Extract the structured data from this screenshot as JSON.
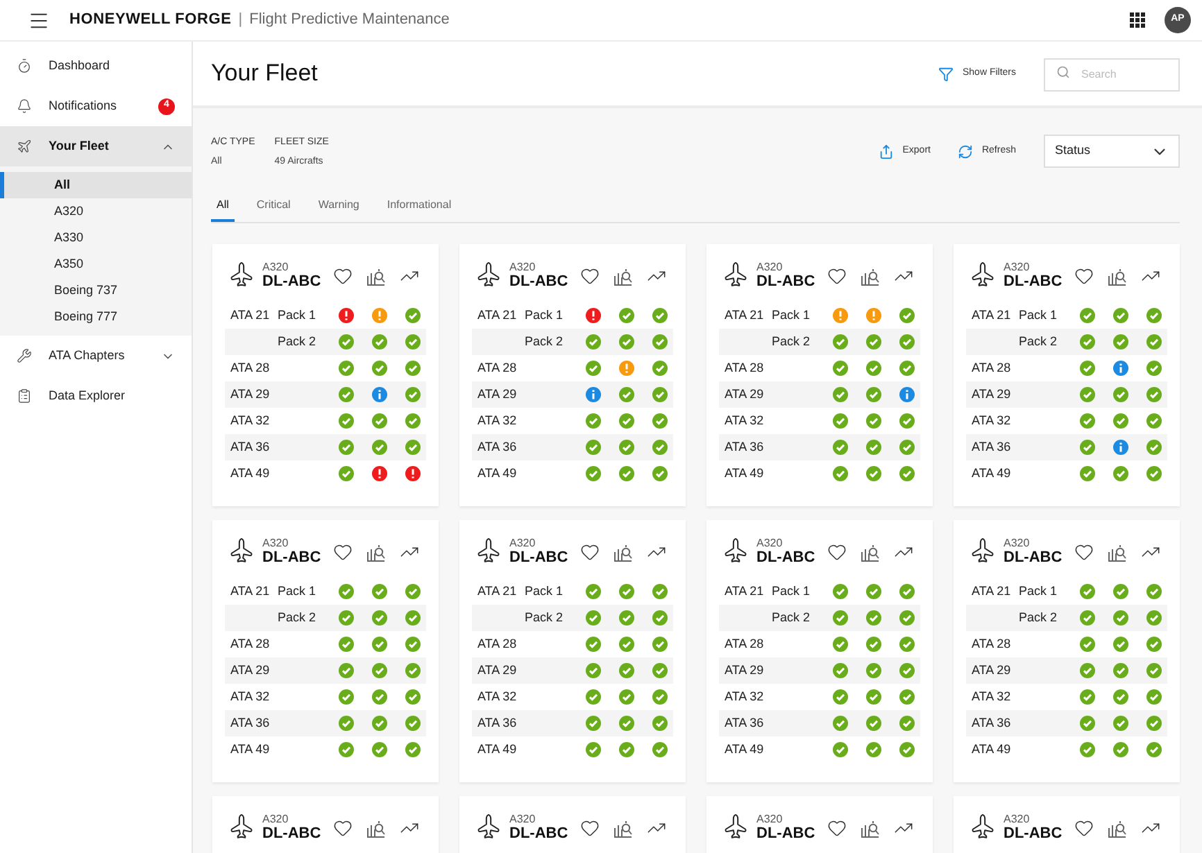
{
  "header": {
    "brand": "HONEYWELL FORGE",
    "separator": "|",
    "product": "Flight Predictive Maintenance",
    "avatar": "AP"
  },
  "sidebar": {
    "items": [
      {
        "label": "Dashboard",
        "selected": false
      },
      {
        "label": "Notifications",
        "badge": "4",
        "selected": false
      },
      {
        "label": "Your Fleet",
        "expanded": true,
        "selected": true,
        "children": [
          {
            "label": "All",
            "selected": true
          },
          {
            "label": "A320",
            "selected": false
          },
          {
            "label": "A330",
            "selected": false
          },
          {
            "label": "A350",
            "selected": false
          },
          {
            "label": "Boeing 737",
            "selected": false
          },
          {
            "label": "Boeing 777",
            "selected": false
          }
        ]
      },
      {
        "label": "ATA Chapters",
        "expanded": false,
        "selected": false
      },
      {
        "label": "Data Explorer",
        "selected": false
      }
    ]
  },
  "page": {
    "title": "Your Fleet",
    "show_filters": "Show Filters",
    "search": {
      "placeholder": "Search"
    }
  },
  "summary": [
    {
      "label": "A/C TYPE",
      "value": "All"
    },
    {
      "label": "FLEET SIZE",
      "value": "49 Aircrafts"
    }
  ],
  "actions": [
    "Export",
    "Refresh"
  ],
  "sort": {
    "value": "Status"
  },
  "tabs": [
    {
      "label": "All",
      "selected": true
    },
    {
      "label": "Critical",
      "selected": false
    },
    {
      "label": "Warning",
      "selected": false
    },
    {
      "label": "Informational",
      "selected": false
    }
  ],
  "cards": [
    {
      "type": "A320",
      "tail": "DL-ABC",
      "rows": [
        {
          "ata": "ATA 21",
          "sub": "Pack 1",
          "statuses": [
            {
              "kind": "critical"
            },
            {
              "kind": "warning"
            },
            {
              "kind": "ok"
            }
          ]
        },
        {
          "sub": "Pack 2",
          "statuses": [
            {
              "kind": "ok"
            },
            {
              "kind": "ok"
            },
            {
              "kind": "ok"
            }
          ]
        },
        {
          "ata": "ATA 28",
          "statuses": [
            {
              "kind": "ok"
            },
            {
              "kind": "ok"
            },
            {
              "kind": "ok"
            }
          ]
        },
        {
          "ata": "ATA 29",
          "statuses": [
            {
              "kind": "ok"
            },
            {
              "kind": "info"
            },
            {
              "kind": "ok"
            }
          ]
        },
        {
          "ata": "ATA 32",
          "statuses": [
            {
              "kind": "ok"
            },
            {
              "kind": "ok"
            },
            {
              "kind": "ok"
            }
          ]
        },
        {
          "ata": "ATA 36",
          "statuses": [
            {
              "kind": "ok"
            },
            {
              "kind": "ok"
            },
            {
              "kind": "ok"
            }
          ]
        },
        {
          "ata": "ATA 49",
          "statuses": [
            {
              "kind": "ok"
            },
            {
              "kind": "critical"
            },
            {
              "kind": "critical"
            }
          ]
        }
      ]
    },
    {
      "type": "A320",
      "tail": "DL-ABC",
      "rows": [
        {
          "ata": "ATA 21",
          "sub": "Pack 1",
          "statuses": [
            {
              "kind": "critical"
            },
            {
              "kind": "ok"
            },
            {
              "kind": "ok"
            }
          ]
        },
        {
          "sub": "Pack 2",
          "statuses": [
            {
              "kind": "ok"
            },
            {
              "kind": "ok"
            },
            {
              "kind": "ok"
            }
          ]
        },
        {
          "ata": "ATA 28",
          "statuses": [
            {
              "kind": "ok"
            },
            {
              "kind": "warning"
            },
            {
              "kind": "ok"
            }
          ]
        },
        {
          "ata": "ATA 29",
          "statuses": [
            {
              "kind": "info"
            },
            {
              "kind": "ok"
            },
            {
              "kind": "ok"
            }
          ]
        },
        {
          "ata": "ATA 32",
          "statuses": [
            {
              "kind": "ok"
            },
            {
              "kind": "ok"
            },
            {
              "kind": "ok"
            }
          ]
        },
        {
          "ata": "ATA 36",
          "statuses": [
            {
              "kind": "ok"
            },
            {
              "kind": "ok"
            },
            {
              "kind": "ok"
            }
          ]
        },
        {
          "ata": "ATA 49",
          "statuses": [
            {
              "kind": "ok"
            },
            {
              "kind": "ok"
            },
            {
              "kind": "ok"
            }
          ]
        }
      ]
    },
    {
      "type": "A320",
      "tail": "DL-ABC",
      "rows": [
        {
          "ata": "ATA 21",
          "sub": "Pack 1",
          "statuses": [
            {
              "kind": "warning"
            },
            {
              "kind": "warning"
            },
            {
              "kind": "ok"
            }
          ]
        },
        {
          "sub": "Pack 2",
          "statuses": [
            {
              "kind": "ok"
            },
            {
              "kind": "ok"
            },
            {
              "kind": "ok"
            }
          ]
        },
        {
          "ata": "ATA 28",
          "statuses": [
            {
              "kind": "ok"
            },
            {
              "kind": "ok"
            },
            {
              "kind": "ok"
            }
          ]
        },
        {
          "ata": "ATA 29",
          "statuses": [
            {
              "kind": "ok"
            },
            {
              "kind": "ok"
            },
            {
              "kind": "info"
            }
          ]
        },
        {
          "ata": "ATA 32",
          "statuses": [
            {
              "kind": "ok"
            },
            {
              "kind": "ok"
            },
            {
              "kind": "ok"
            }
          ]
        },
        {
          "ata": "ATA 36",
          "statuses": [
            {
              "kind": "ok"
            },
            {
              "kind": "ok"
            },
            {
              "kind": "ok"
            }
          ]
        },
        {
          "ata": "ATA 49",
          "statuses": [
            {
              "kind": "ok"
            },
            {
              "kind": "ok"
            },
            {
              "kind": "ok"
            }
          ]
        }
      ]
    },
    {
      "type": "A320",
      "tail": "DL-ABC",
      "rows": [
        {
          "ata": "ATA 21",
          "sub": "Pack 1",
          "statuses": [
            {
              "kind": "ok"
            },
            {
              "kind": "ok"
            },
            {
              "kind": "ok"
            }
          ]
        },
        {
          "sub": "Pack 2",
          "statuses": [
            {
              "kind": "ok"
            },
            {
              "kind": "ok"
            },
            {
              "kind": "ok"
            }
          ]
        },
        {
          "ata": "ATA 28",
          "statuses": [
            {
              "kind": "ok"
            },
            {
              "kind": "info"
            },
            {
              "kind": "ok"
            }
          ]
        },
        {
          "ata": "ATA 29",
          "statuses": [
            {
              "kind": "ok"
            },
            {
              "kind": "ok"
            },
            {
              "kind": "ok"
            }
          ]
        },
        {
          "ata": "ATA 32",
          "statuses": [
            {
              "kind": "ok"
            },
            {
              "kind": "ok"
            },
            {
              "kind": "ok"
            }
          ]
        },
        {
          "ata": "ATA 36",
          "statuses": [
            {
              "kind": "ok"
            },
            {
              "kind": "info"
            },
            {
              "kind": "ok"
            }
          ]
        },
        {
          "ata": "ATA 49",
          "statuses": [
            {
              "kind": "ok"
            },
            {
              "kind": "ok"
            },
            {
              "kind": "ok"
            }
          ]
        }
      ]
    },
    {
      "type": "A320",
      "tail": "DL-ABC",
      "rows": [
        {
          "ata": "ATA 21",
          "sub": "Pack 1",
          "statuses": [
            {
              "kind": "ok"
            },
            {
              "kind": "ok"
            },
            {
              "kind": "ok"
            }
          ]
        },
        {
          "sub": "Pack 2",
          "statuses": [
            {
              "kind": "ok"
            },
            {
              "kind": "ok"
            },
            {
              "kind": "ok"
            }
          ]
        },
        {
          "ata": "ATA 28",
          "statuses": [
            {
              "kind": "ok"
            },
            {
              "kind": "ok"
            },
            {
              "kind": "ok"
            }
          ]
        },
        {
          "ata": "ATA 29",
          "statuses": [
            {
              "kind": "ok"
            },
            {
              "kind": "ok"
            },
            {
              "kind": "ok"
            }
          ]
        },
        {
          "ata": "ATA 32",
          "statuses": [
            {
              "kind": "ok"
            },
            {
              "kind": "ok"
            },
            {
              "kind": "ok"
            }
          ]
        },
        {
          "ata": "ATA 36",
          "statuses": [
            {
              "kind": "ok"
            },
            {
              "kind": "ok"
            },
            {
              "kind": "ok"
            }
          ]
        },
        {
          "ata": "ATA 49",
          "statuses": [
            {
              "kind": "ok"
            },
            {
              "kind": "ok"
            },
            {
              "kind": "ok"
            }
          ]
        }
      ]
    },
    {
      "type": "A320",
      "tail": "DL-ABC",
      "rows": [
        {
          "ata": "ATA 21",
          "sub": "Pack 1",
          "statuses": [
            {
              "kind": "ok"
            },
            {
              "kind": "ok"
            },
            {
              "kind": "ok"
            }
          ]
        },
        {
          "sub": "Pack 2",
          "statuses": [
            {
              "kind": "ok"
            },
            {
              "kind": "ok"
            },
            {
              "kind": "ok"
            }
          ]
        },
        {
          "ata": "ATA 28",
          "statuses": [
            {
              "kind": "ok"
            },
            {
              "kind": "ok"
            },
            {
              "kind": "ok"
            }
          ]
        },
        {
          "ata": "ATA 29",
          "statuses": [
            {
              "kind": "ok"
            },
            {
              "kind": "ok"
            },
            {
              "kind": "ok"
            }
          ]
        },
        {
          "ata": "ATA 32",
          "statuses": [
            {
              "kind": "ok"
            },
            {
              "kind": "ok"
            },
            {
              "kind": "ok"
            }
          ]
        },
        {
          "ata": "ATA 36",
          "statuses": [
            {
              "kind": "ok"
            },
            {
              "kind": "ok"
            },
            {
              "kind": "ok"
            }
          ]
        },
        {
          "ata": "ATA 49",
          "statuses": [
            {
              "kind": "ok"
            },
            {
              "kind": "ok"
            },
            {
              "kind": "ok"
            }
          ]
        }
      ]
    },
    {
      "type": "A320",
      "tail": "DL-ABC",
      "rows": [
        {
          "ata": "ATA 21",
          "sub": "Pack 1",
          "statuses": [
            {
              "kind": "ok"
            },
            {
              "kind": "ok"
            },
            {
              "kind": "ok"
            }
          ]
        },
        {
          "sub": "Pack 2",
          "statuses": [
            {
              "kind": "ok"
            },
            {
              "kind": "ok"
            },
            {
              "kind": "ok"
            }
          ]
        },
        {
          "ata": "ATA 28",
          "statuses": [
            {
              "kind": "ok"
            },
            {
              "kind": "ok"
            },
            {
              "kind": "ok"
            }
          ]
        },
        {
          "ata": "ATA 29",
          "statuses": [
            {
              "kind": "ok"
            },
            {
              "kind": "ok"
            },
            {
              "kind": "ok"
            }
          ]
        },
        {
          "ata": "ATA 32",
          "statuses": [
            {
              "kind": "ok"
            },
            {
              "kind": "ok"
            },
            {
              "kind": "ok"
            }
          ]
        },
        {
          "ata": "ATA 36",
          "statuses": [
            {
              "kind": "ok"
            },
            {
              "kind": "ok"
            },
            {
              "kind": "ok"
            }
          ]
        },
        {
          "ata": "ATA 49",
          "statuses": [
            {
              "kind": "ok"
            },
            {
              "kind": "ok"
            },
            {
              "kind": "ok"
            }
          ]
        }
      ]
    },
    {
      "type": "A320",
      "tail": "DL-ABC",
      "rows": [
        {
          "ata": "ATA 21",
          "sub": "Pack 1",
          "statuses": [
            {
              "kind": "ok"
            },
            {
              "kind": "ok"
            },
            {
              "kind": "ok"
            }
          ]
        },
        {
          "sub": "Pack 2",
          "statuses": [
            {
              "kind": "ok"
            },
            {
              "kind": "ok"
            },
            {
              "kind": "ok"
            }
          ]
        },
        {
          "ata": "ATA 28",
          "statuses": [
            {
              "kind": "ok"
            },
            {
              "kind": "ok"
            },
            {
              "kind": "ok"
            }
          ]
        },
        {
          "ata": "ATA 29",
          "statuses": [
            {
              "kind": "ok"
            },
            {
              "kind": "ok"
            },
            {
              "kind": "ok"
            }
          ]
        },
        {
          "ata": "ATA 32",
          "statuses": [
            {
              "kind": "ok"
            },
            {
              "kind": "ok"
            },
            {
              "kind": "ok"
            }
          ]
        },
        {
          "ata": "ATA 36",
          "statuses": [
            {
              "kind": "ok"
            },
            {
              "kind": "ok"
            },
            {
              "kind": "ok"
            }
          ]
        },
        {
          "ata": "ATA 49",
          "statuses": [
            {
              "kind": "ok"
            },
            {
              "kind": "ok"
            },
            {
              "kind": "ok"
            }
          ]
        }
      ]
    },
    {
      "type": "A320",
      "tail": "DL-ABC"
    },
    {
      "type": "A320",
      "tail": "DL-ABC"
    },
    {
      "type": "A320",
      "tail": "DL-ABC"
    },
    {
      "type": "A320",
      "tail": "DL-ABC"
    }
  ]
}
